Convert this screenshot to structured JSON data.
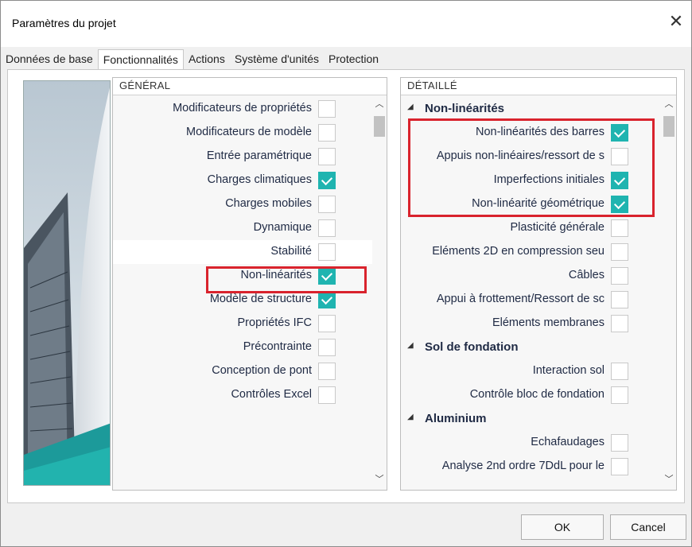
{
  "dialog": {
    "title": "Paramètres du projet"
  },
  "tabs": [
    {
      "label": "Données de base",
      "active": false
    },
    {
      "label": "Fonctionnalités",
      "active": true
    },
    {
      "label": "Actions",
      "active": false
    },
    {
      "label": "Système d'unités",
      "active": false
    },
    {
      "label": "Protection",
      "active": false
    }
  ],
  "general": {
    "header": "GÉNÉRAL",
    "items": [
      {
        "label": "Modificateurs de propriétés",
        "checked": false
      },
      {
        "label": "Modificateurs de modèle",
        "checked": false
      },
      {
        "label": "Entrée paramétrique",
        "checked": false
      },
      {
        "label": "Charges climatiques",
        "checked": true
      },
      {
        "label": "Charges mobiles",
        "checked": false
      },
      {
        "label": "Dynamique",
        "checked": false
      },
      {
        "label": "Stabilité",
        "checked": false
      },
      {
        "label": "Non-linéarités",
        "checked": true
      },
      {
        "label": "Modèle de structure",
        "checked": true
      },
      {
        "label": "Propriétés IFC",
        "checked": false
      },
      {
        "label": "Précontrainte",
        "checked": false
      },
      {
        "label": "Conception de pont",
        "checked": false
      },
      {
        "label": "Contrôles Excel",
        "checked": false
      }
    ]
  },
  "detail": {
    "header": "DÉTAILLÉ",
    "groups": [
      {
        "label": "Non-linéarités",
        "items": [
          {
            "label": "Non-linéarités des barres",
            "checked": true
          },
          {
            "label": "Appuis non-linéaires/ressort de s",
            "checked": false
          },
          {
            "label": "Imperfections initiales",
            "checked": true
          },
          {
            "label": "Non-linéarité géométrique",
            "checked": true
          },
          {
            "label": "Plasticité générale",
            "checked": false
          },
          {
            "label": "Eléments 2D en compression seu",
            "checked": false
          },
          {
            "label": "Câbles",
            "checked": false
          },
          {
            "label": "Appui à frottement/Ressort de sc",
            "checked": false
          },
          {
            "label": "Eléments membranes",
            "checked": false
          }
        ]
      },
      {
        "label": "Sol de fondation",
        "items": [
          {
            "label": "Interaction sol",
            "checked": false
          },
          {
            "label": "Contrôle bloc de fondation",
            "checked": false
          }
        ]
      },
      {
        "label": "Aluminium",
        "items": [
          {
            "label": "Echafaudages",
            "checked": false
          },
          {
            "label": "Analyse 2nd ordre 7DdL pour le",
            "checked": false
          }
        ]
      }
    ]
  },
  "buttons": {
    "ok": "OK",
    "cancel": "Cancel"
  },
  "colors": {
    "checked": "#1fb4b0",
    "highlight": "#d9232d"
  },
  "icons": {
    "close": "close-icon",
    "scroll_up": "chevron-up-icon",
    "scroll_down": "chevron-down-icon",
    "collapse": "caret-down-icon"
  }
}
